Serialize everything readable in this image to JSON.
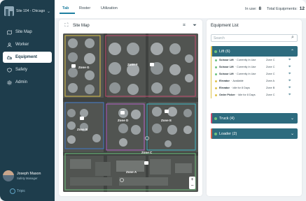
{
  "sidebar": {
    "site_label": "Site 104 - Chicago",
    "items": [
      {
        "label": "Site Map",
        "icon": "map-icon"
      },
      {
        "label": "Worker",
        "icon": "worker-icon"
      },
      {
        "label": "Equipment",
        "icon": "equipment-icon",
        "active": true
      },
      {
        "label": "Safety",
        "icon": "shield-icon"
      },
      {
        "label": "Admin",
        "icon": "gear-icon"
      }
    ],
    "user": {
      "name": "Joseph Mason",
      "role": "Safety Manager"
    },
    "logo_text": "Tripic"
  },
  "topbar": {
    "tabs": [
      "Tab",
      "Roster",
      "Utilization"
    ],
    "in_use_label": "In use:",
    "in_use_value": "8",
    "total_label": "Total Equipments:",
    "total_value": "12"
  },
  "site_map": {
    "title": "Site Map",
    "zones": [
      "Zone A",
      "Zone B",
      "Zone C",
      "Zone D",
      "Zone E",
      "Zone F",
      "Zone G"
    ]
  },
  "equipment_list": {
    "title": "Equipment List",
    "search_placeholder": "Search",
    "groups": [
      {
        "label": "Lift (6)",
        "color": "#e0c34a",
        "expanded": true,
        "items": [
          {
            "name": "Scissor Lift",
            "status": "Currently In Use",
            "zone": "Zone C",
            "dot": "#6ec27e"
          },
          {
            "name": "Scissor Lift",
            "status": "Currently In Use",
            "zone": "Zone C",
            "dot": "#6ec27e"
          },
          {
            "name": "Scissor Lift",
            "status": "Currently In Use",
            "zone": "Zone C",
            "dot": "#6ec27e"
          },
          {
            "name": "Elevator",
            "status": "Available",
            "zone": "Zone A",
            "dot": "#e0c34a"
          },
          {
            "name": "Elevator",
            "status": "Idle for 8 Days",
            "zone": "Zone B",
            "dot": "#e0c34a"
          },
          {
            "name": "Order Picker",
            "status": "Idle for 8 Days",
            "zone": "Zone C",
            "dot": "#e0c34a"
          }
        ]
      },
      {
        "label": "Truck (4)",
        "color": "#c84b6e",
        "expanded": false
      },
      {
        "label": "Loader (2)",
        "color": "#d8614a",
        "expanded": false
      }
    ]
  }
}
